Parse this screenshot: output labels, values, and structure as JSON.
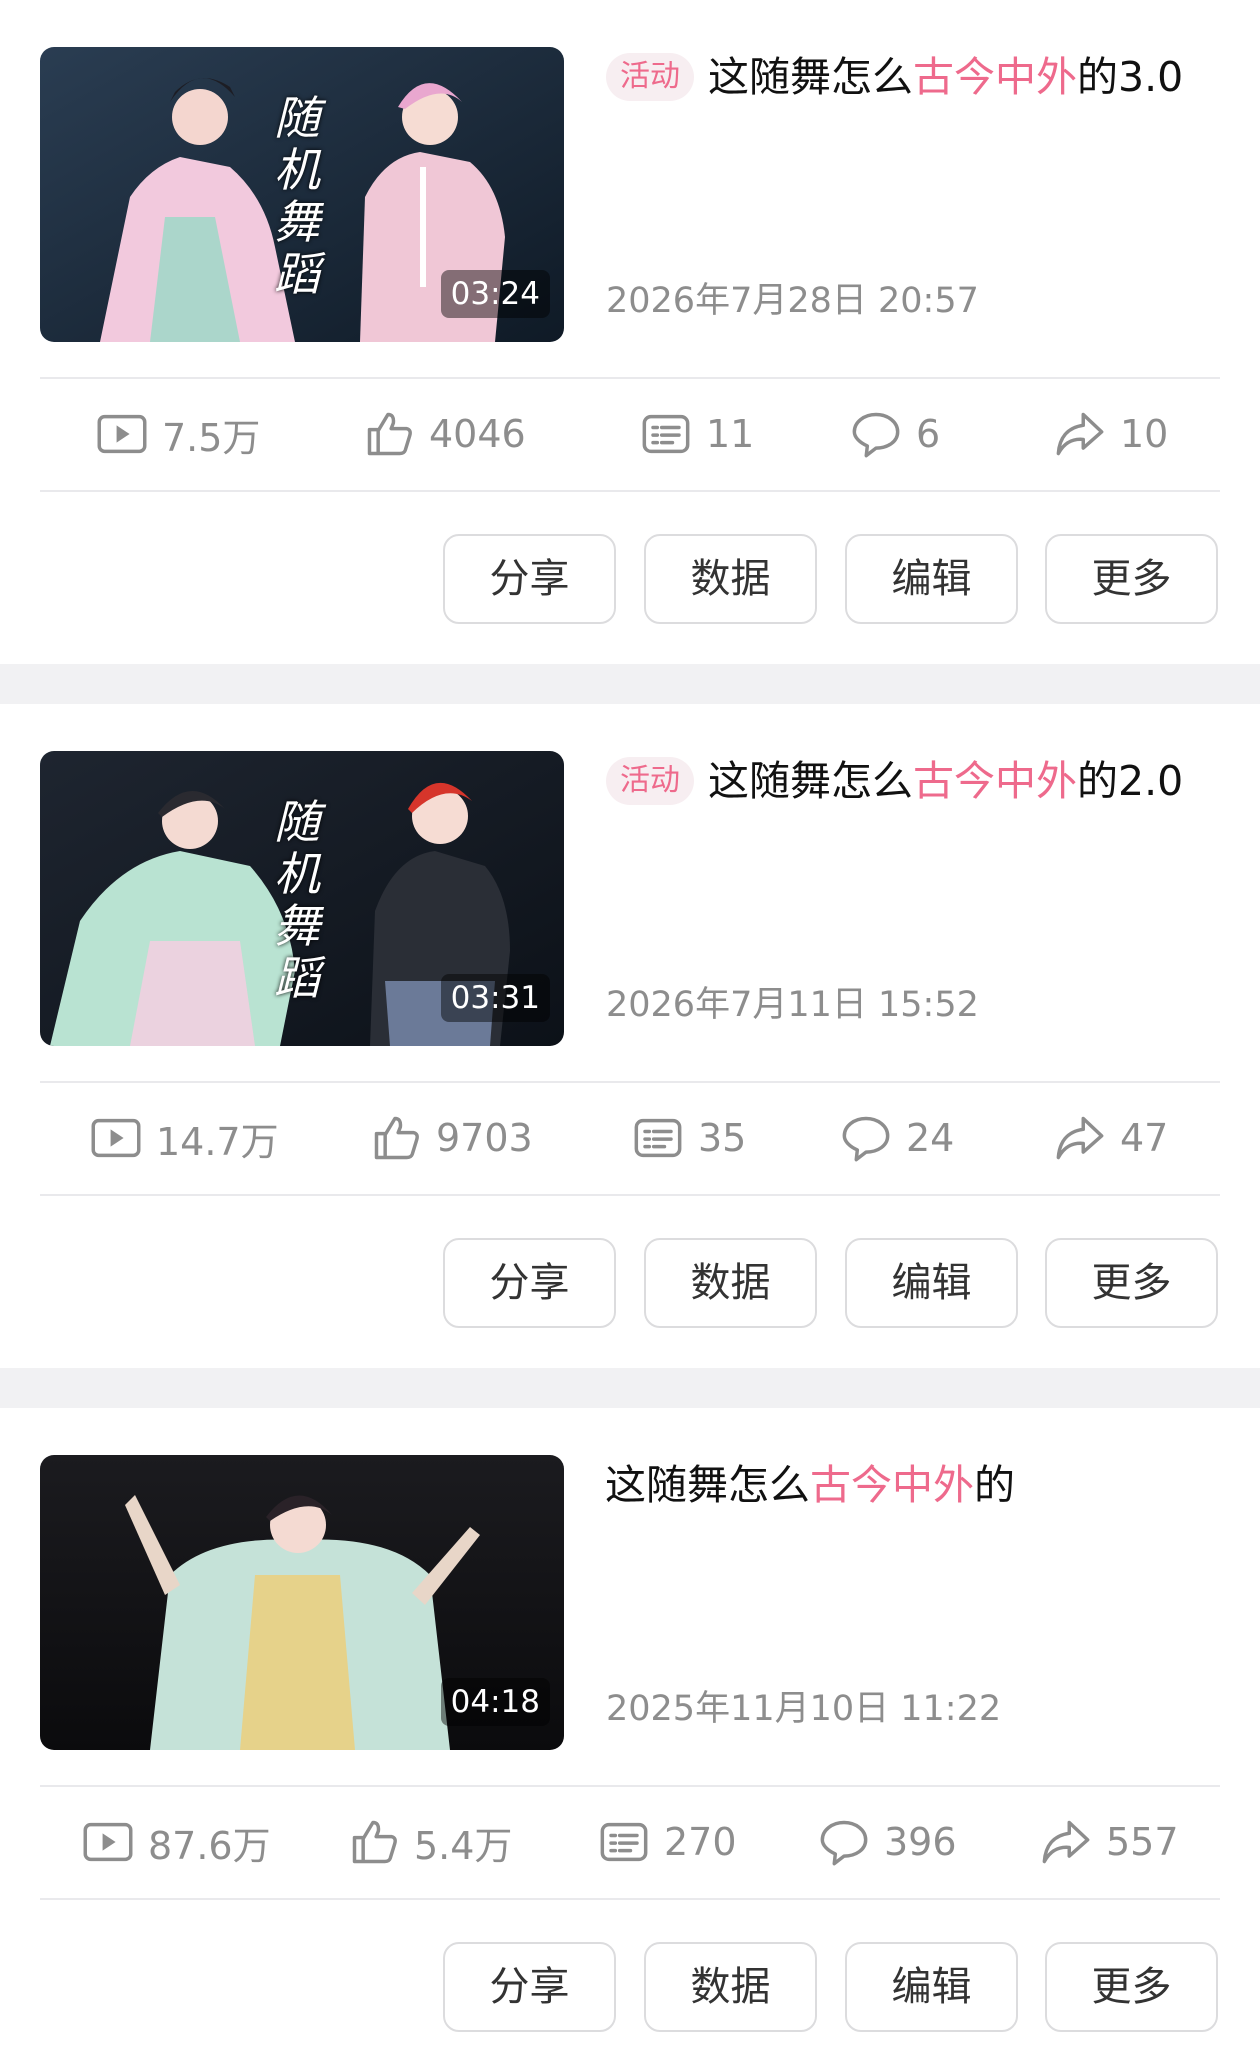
{
  "colors": {
    "accent": "#ee6a8c",
    "muted": "#8d8d8d",
    "separator": "#f1f1f3"
  },
  "icons": {
    "views": "play-icon",
    "likes": "thumbs-up-icon",
    "danmaku": "danmaku-icon",
    "comments": "comment-icon",
    "shares": "share-icon"
  },
  "buttons": {
    "share": "分享",
    "data": "数据",
    "edit": "编辑",
    "more": "更多"
  },
  "videos": [
    {
      "thumb_overlay": [
        "随",
        "机",
        "舞",
        "蹈"
      ],
      "duration": "03:24",
      "tag": "活动",
      "title_prefix": "这随舞怎么",
      "title_highlight": "古今中外",
      "title_suffix": "的3.0",
      "date": "2026年7月28日 20:57",
      "views": "7.5万",
      "likes": "4046",
      "danmaku": "11",
      "comments": "6",
      "shares": "10"
    },
    {
      "thumb_overlay": [
        "随",
        "机",
        "舞",
        "蹈"
      ],
      "duration": "03:31",
      "tag": "活动",
      "title_prefix": "这随舞怎么",
      "title_highlight": "古今中外",
      "title_suffix": "的2.0",
      "date": "2026年7月11日 15:52",
      "views": "14.7万",
      "likes": "9703",
      "danmaku": "35",
      "comments": "24",
      "shares": "47"
    },
    {
      "duration": "04:18",
      "title_prefix": "这随舞怎么",
      "title_highlight": "古今中外",
      "title_suffix": "的",
      "date": "2025年11月10日 11:22",
      "views": "87.6万",
      "likes": "5.4万",
      "danmaku": "270",
      "comments": "396",
      "shares": "557"
    }
  ]
}
